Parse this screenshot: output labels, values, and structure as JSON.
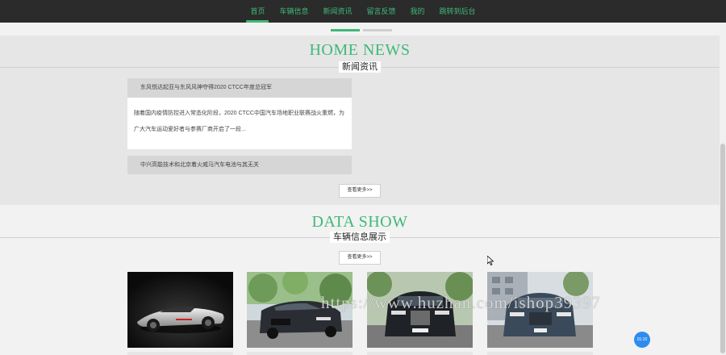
{
  "nav": {
    "items": [
      {
        "label": "首页",
        "active": true
      },
      {
        "label": "车辆信息",
        "active": false
      },
      {
        "label": "新闻资讯",
        "active": false
      },
      {
        "label": "留言反馈",
        "active": false
      },
      {
        "label": "我的",
        "active": false
      },
      {
        "label": "跳转到后台",
        "active": false
      }
    ]
  },
  "news": {
    "title": "HOME NEWS",
    "subtitle": "新闻资讯",
    "featured": {
      "headline": "东风悦达起亚与东风风神夺得2020 CTCC年度总冠军",
      "summary": "随着国内疫情防控进入常态化阶段，2020 CTCC中国汽车场地职业联赛战火重燃，为广大汽车运动爱好者与参赛厂商开启了一段..."
    },
    "second_headline": "中兴高能技术和北京着火威马汽车电池与其无关",
    "more_label": "查看更多>>"
  },
  "data_show": {
    "title": "DATA SHOW",
    "subtitle": "车辆信息展示",
    "more_label": "查看更多>>"
  },
  "watermark": "https://www.huzhan.com/ishop39397",
  "timer": "01:10",
  "colors": {
    "accent": "#3fb878",
    "timer_bg": "#2d8cf0"
  }
}
